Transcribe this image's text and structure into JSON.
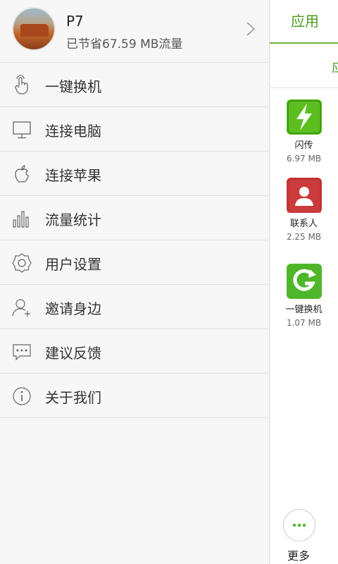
{
  "drawer": {
    "profile": {
      "name": "P7",
      "saved_text": "已节省67.59 MB流量"
    },
    "items": [
      {
        "label": "一键换机",
        "icon": "hand-tap-icon"
      },
      {
        "label": "连接电脑",
        "icon": "monitor-icon"
      },
      {
        "label": "连接苹果",
        "icon": "apple-icon"
      },
      {
        "label": "流量统计",
        "icon": "bar-chart-icon"
      },
      {
        "label": "用户设置",
        "icon": "gear-icon"
      },
      {
        "label": "邀请身边",
        "icon": "add-user-icon"
      },
      {
        "label": "建议反馈",
        "icon": "chat-bubble-icon"
      },
      {
        "label": "关于我们",
        "icon": "info-icon"
      }
    ]
  },
  "right_panel": {
    "tab_active": "应用",
    "subtab_partial": "应",
    "apps": [
      {
        "name": "闪传",
        "size": "6.97 MB",
        "color": "#5cbf1f",
        "icon": "lightning-icon"
      },
      {
        "name": "联系人",
        "size": "2.25 MB",
        "color": "#cc3b3b",
        "icon": "contact-icon"
      },
      {
        "name": "一键换机",
        "size": "1.07 MB",
        "color": "#4fb62a",
        "icon": "g-arrow-icon"
      }
    ],
    "more_label": "更多"
  },
  "colors": {
    "accent_green": "#4a9c1d",
    "drawer_bg": "#f7f7f7"
  }
}
